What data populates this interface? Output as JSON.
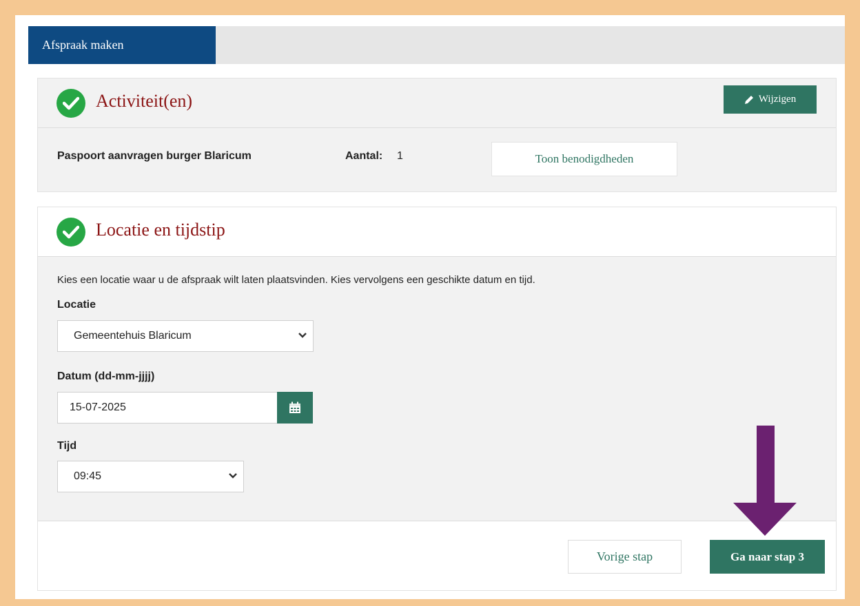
{
  "tabs": {
    "active_label": "Afspraak maken"
  },
  "activities": {
    "title": "Activiteit(en)",
    "edit_label": "Wijzigen",
    "item_name": "Paspoort aanvragen burger Blaricum",
    "count_label": "Aantal:",
    "count_value": "1",
    "show_requirements_label": "Toon benodigdheden"
  },
  "location_time": {
    "title": "Locatie en tijdstip",
    "intro": "Kies een locatie waar u de afspraak wilt laten plaatsvinden. Kies vervolgens een geschikte datum en tijd.",
    "location_label": "Locatie",
    "location_value": "Gemeentehuis Blaricum",
    "date_label": "Datum (dd-mm-jjjj)",
    "date_value": "15-07-2025",
    "time_label": "Tijd",
    "time_value": "09:45"
  },
  "footer": {
    "prev_label": "Vorige stap",
    "next_label": "Ga naar stap 3"
  },
  "colors": {
    "accent_green": "#2f7562",
    "check_green": "#27a745",
    "tab_blue": "#0e4a82",
    "heading_red": "#8b1414",
    "annotation_arrow": "#6b2170",
    "frame_border": "#f5c892"
  },
  "icons": [
    "check-circle-icon",
    "pencil-icon",
    "chevron-down-icon",
    "calendar-icon",
    "down-arrow-annotation"
  ]
}
